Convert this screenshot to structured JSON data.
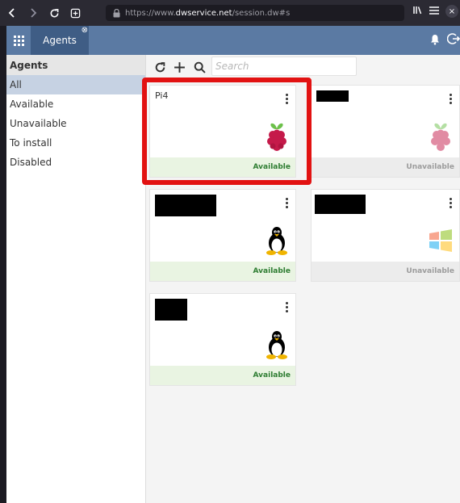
{
  "browser": {
    "url_scheme": "https://www.",
    "url_host": "dwservice.net",
    "url_path": "/session.dw#s"
  },
  "header": {
    "tab_label": "Agents"
  },
  "sidebar": {
    "title": "Agents",
    "items": [
      {
        "label": "All",
        "active": true
      },
      {
        "label": "Available"
      },
      {
        "label": "Unavailable"
      },
      {
        "label": "To install"
      },
      {
        "label": "Disabled"
      }
    ]
  },
  "search": {
    "placeholder": "Search"
  },
  "agents": [
    {
      "name": "Pi4",
      "os": "raspberry-pi-icon",
      "status": "Available"
    },
    {
      "name": "",
      "os": "raspberry-pi-icon",
      "status": "Unavailable"
    },
    {
      "name": "",
      "os": "linux-tux-icon",
      "status": "Available"
    },
    {
      "name": "",
      "os": "windows-icon",
      "status": "Unavailable"
    },
    {
      "name": "",
      "os": "linux-tux-icon",
      "status": "Available"
    }
  ],
  "colors": {
    "header": "#5b7aa3",
    "active_tab": "#3f5d85",
    "available": "#2e7d32",
    "highlight": "#e21212"
  }
}
